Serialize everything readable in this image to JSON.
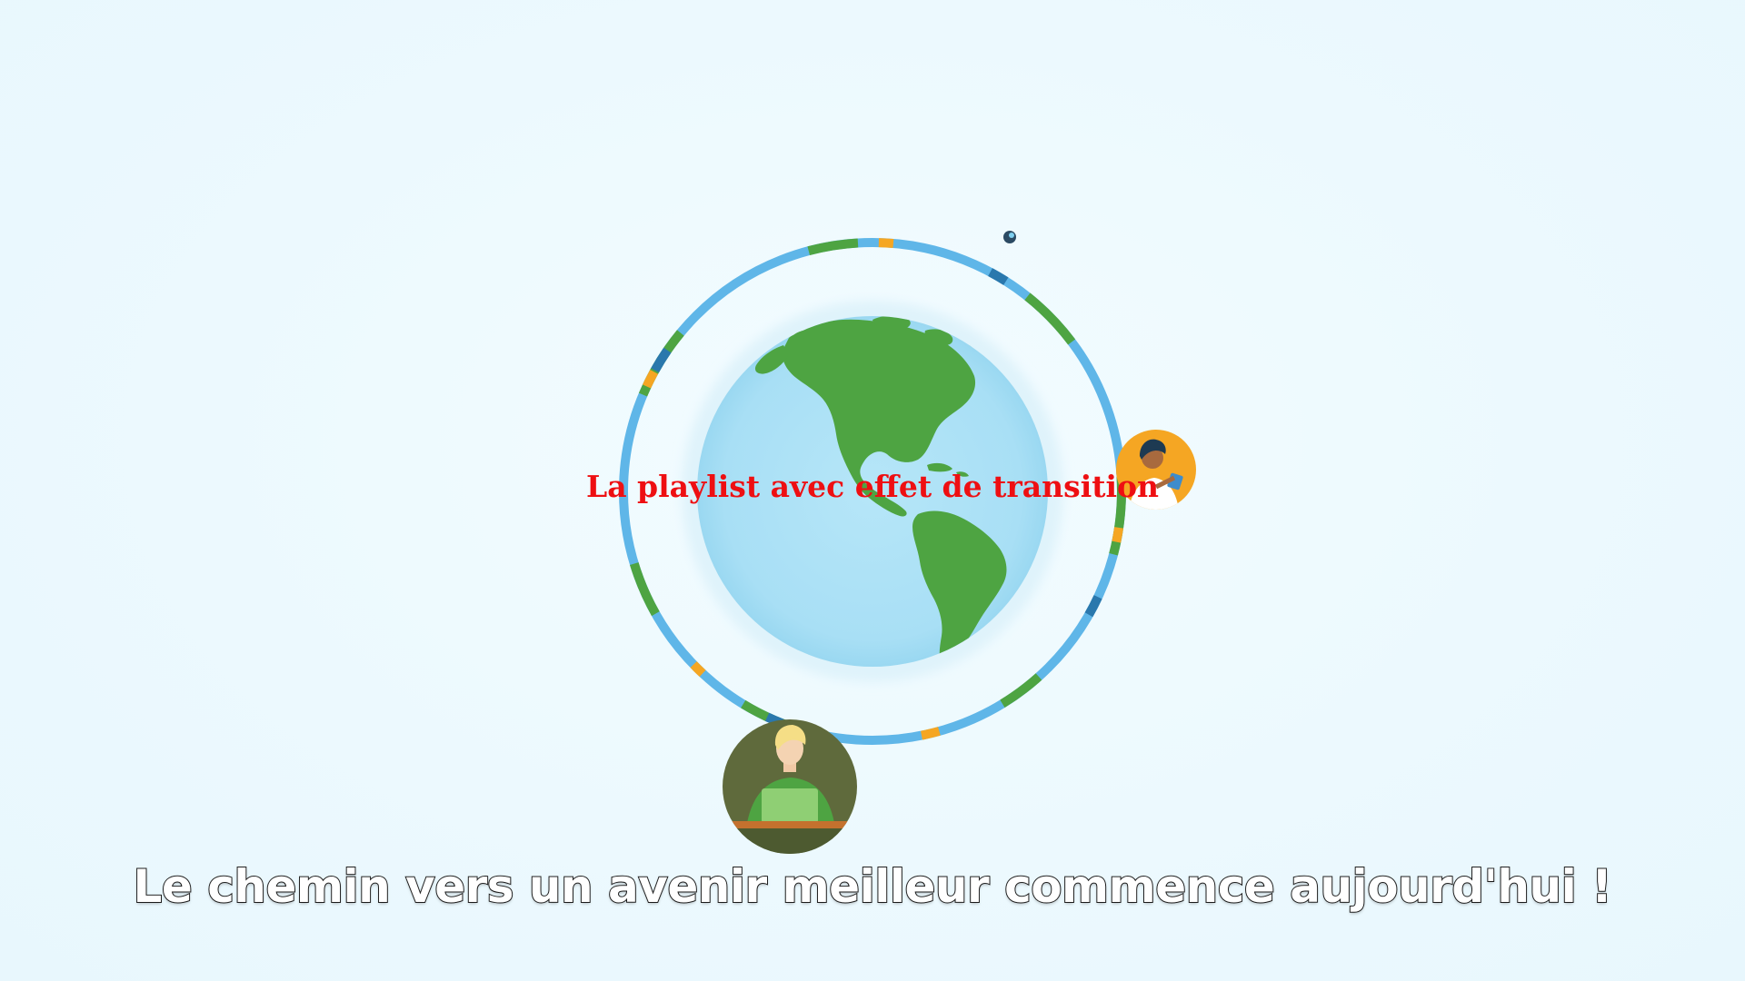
{
  "video": {
    "overlay_title": "La playlist avec effet de transition",
    "subtitle": "Le chemin vers un avenir meilleur commence aujourd'hui !"
  },
  "colors": {
    "background": "#ecf9fe",
    "ocean": "#aee2f6",
    "land": "#4ea442",
    "ring_light_blue": "#5fb6e8",
    "ring_dark_blue": "#2a78ad",
    "ring_green": "#4ea442",
    "ring_orange": "#f5a623",
    "overlay_title": "#ee0f12"
  },
  "icons": {
    "globe": "earth-americas-icon",
    "person_top_right": "doctor-avatar-icon",
    "person_bottom": "student-avatar-icon",
    "small_dot": "satellite-dot-icon"
  }
}
